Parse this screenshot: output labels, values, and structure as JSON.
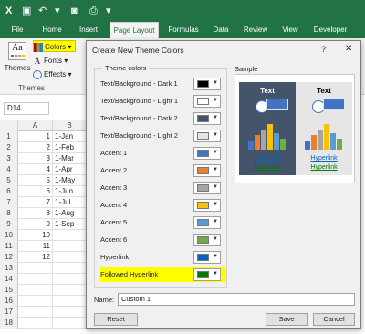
{
  "title_bar": {
    "icons": [
      "excel-icon",
      "save-icon",
      "undo-icon",
      "camera-icon",
      "print-icon",
      "customize-icon"
    ]
  },
  "tabs": [
    "File",
    "Home",
    "Insert",
    "Page Layout",
    "Formulas",
    "Data",
    "Review",
    "View",
    "Developer"
  ],
  "ribbon": {
    "themes_label": "Themes",
    "colors_label": "Colors",
    "fonts_label": "Fonts",
    "effects_label": "Effects",
    "group_label": "Themes"
  },
  "name_box": "D14",
  "grid": {
    "columns": [
      "A",
      "B"
    ],
    "rows": [
      {
        "n": "1",
        "a": "1",
        "b": "1-Jan"
      },
      {
        "n": "2",
        "a": "2",
        "b": "1-Feb"
      },
      {
        "n": "3",
        "a": "3",
        "b": "1-Mar"
      },
      {
        "n": "4",
        "a": "4",
        "b": "1-Apr"
      },
      {
        "n": "5",
        "a": "5",
        "b": "1-May"
      },
      {
        "n": "6",
        "a": "6",
        "b": "1-Jun"
      },
      {
        "n": "7",
        "a": "7",
        "b": "1-Jul"
      },
      {
        "n": "8",
        "a": "8",
        "b": "1-Aug"
      },
      {
        "n": "9",
        "a": "9",
        "b": "1-Sep"
      },
      {
        "n": "10",
        "a": "10",
        "b": ""
      },
      {
        "n": "11",
        "a": "11",
        "b": ""
      },
      {
        "n": "12",
        "a": "12",
        "b": ""
      },
      {
        "n": "13",
        "a": "",
        "b": ""
      },
      {
        "n": "14",
        "a": "",
        "b": ""
      },
      {
        "n": "15",
        "a": "",
        "b": ""
      },
      {
        "n": "16",
        "a": "",
        "b": ""
      },
      {
        "n": "17",
        "a": "",
        "b": ""
      },
      {
        "n": "18",
        "a": "",
        "b": ""
      }
    ]
  },
  "dialog": {
    "title": "Create New Theme Colors",
    "help": "?",
    "close": "✕",
    "theme_colors_label": "Theme colors",
    "colors": [
      {
        "label": "Text/Background - Dark 1",
        "color": "#000000"
      },
      {
        "label": "Text/Background - Light 1",
        "color": "#ffffff"
      },
      {
        "label": "Text/Background - Dark 2",
        "color": "#44546a"
      },
      {
        "label": "Text/Background - Light 2",
        "color": "#e7e6e6"
      },
      {
        "label": "Accent 1",
        "color": "#4472c4"
      },
      {
        "label": "Accent 2",
        "color": "#ed7d31"
      },
      {
        "label": "Accent 3",
        "color": "#a5a5a5"
      },
      {
        "label": "Accent 4",
        "color": "#ffc000"
      },
      {
        "label": "Accent 5",
        "color": "#5b9bd5"
      },
      {
        "label": "Accent 6",
        "color": "#70ad47"
      },
      {
        "label": "Hyperlink",
        "color": "#0563c1"
      },
      {
        "label": "Followed Hyperlink",
        "color": "#007a00"
      }
    ],
    "sample_label": "Sample",
    "sample_text": "Text",
    "hyperlink": "Hyperlink",
    "name_label": "Name:",
    "name_value": "Custom 1",
    "reset": "Reset",
    "save": "Save",
    "cancel": "Cancel"
  }
}
